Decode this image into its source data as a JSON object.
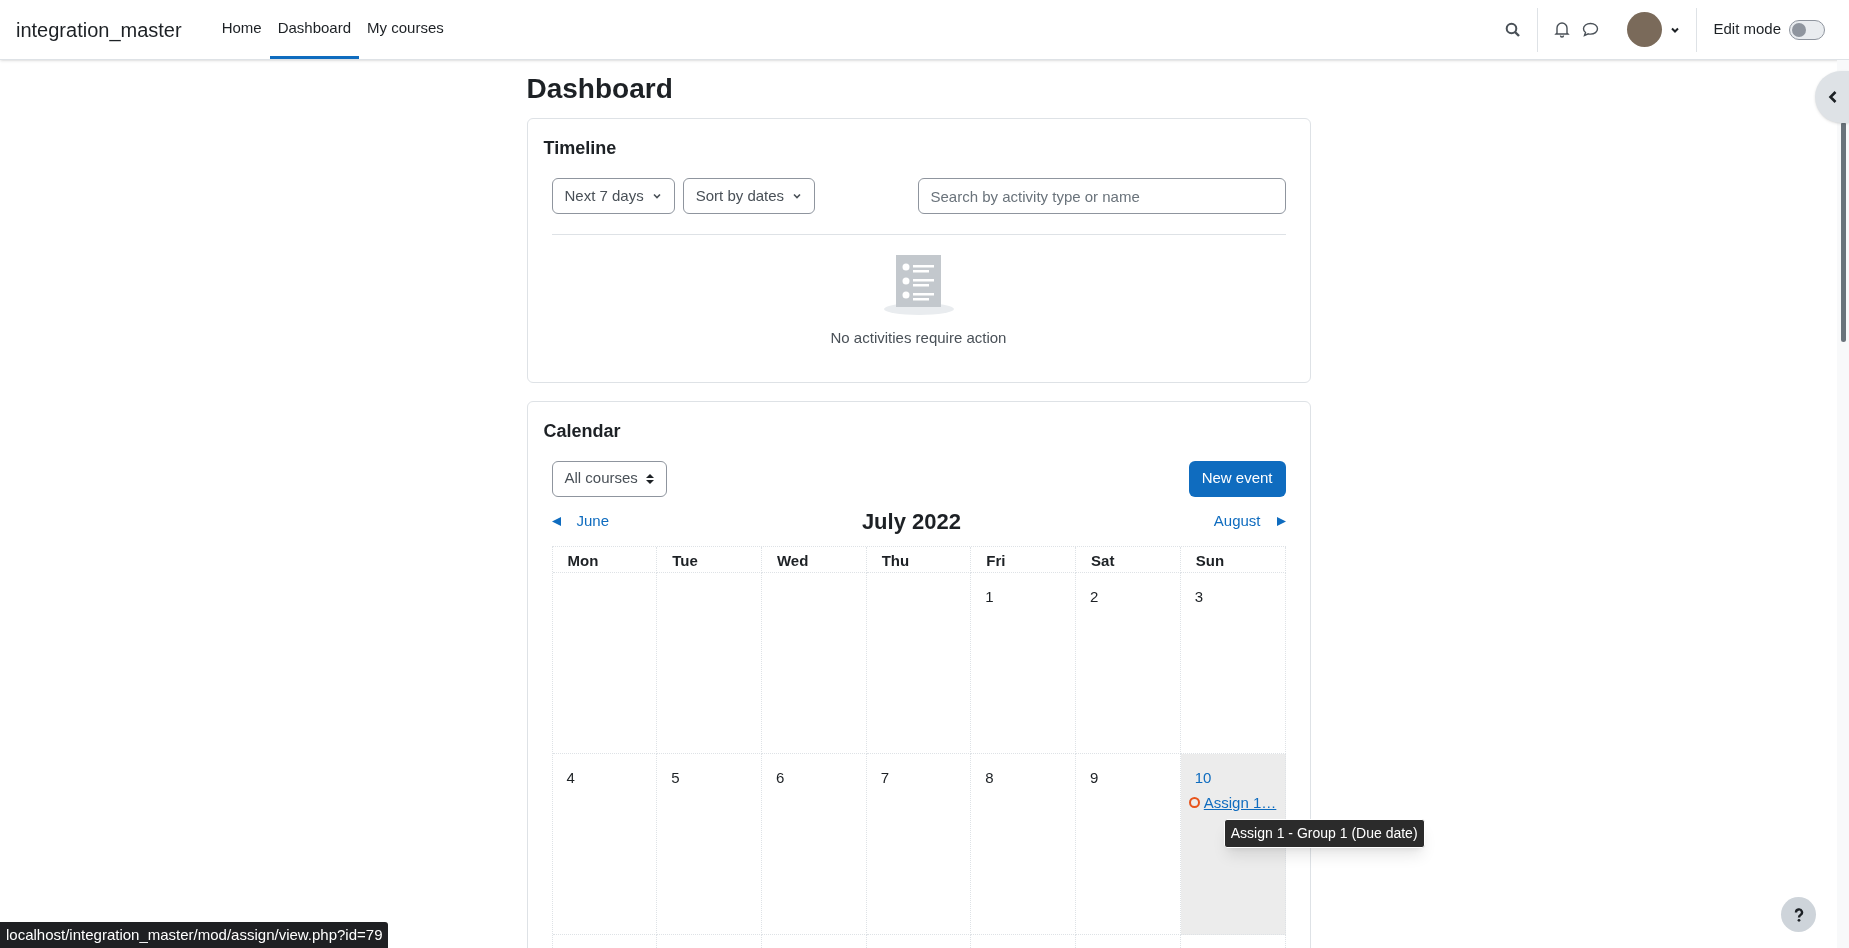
{
  "navbar": {
    "brand": "integration_master",
    "items": [
      {
        "label": "Home",
        "selected": false
      },
      {
        "label": "Dashboard",
        "selected": true
      },
      {
        "label": "My courses",
        "selected": false
      }
    ],
    "edit_mode": {
      "label": "Edit mode",
      "on": false
    }
  },
  "page_title": "Dashboard",
  "timeline": {
    "title": "Timeline",
    "filters": [
      "Next 7 days",
      "Sort by dates"
    ],
    "search": {
      "placeholder": "Search by activity type or name"
    },
    "empty_message": "No activities require action"
  },
  "calendar": {
    "title": "Calendar",
    "course_select": "All courses",
    "new_event_button": "New event",
    "prev_month": "June",
    "month": "July 2022",
    "next_month": "August",
    "weekdays": [
      "Mon",
      "Tue",
      "Wed",
      "Thu",
      "Fri",
      "Sat",
      "Sun"
    ],
    "weeks": [
      [
        {
          "day": "1",
          "today": false
        },
        {
          "day": "2",
          "today": false
        },
        {
          "day": "3",
          "today": false
        }
      ],
      [
        {
          "day": "4",
          "today": false
        },
        {
          "day": "5",
          "today": false
        },
        {
          "day": "6",
          "today": false
        },
        {
          "day": "7",
          "today": false
        },
        {
          "day": "8",
          "today": false
        },
        {
          "day": "9",
          "today": false
        },
        {
          "day": "10",
          "today": true,
          "events": [
            {
              "name": "Assign 1…",
              "color": "#e8541c",
              "tooltip": "Assign 1 - Group 1 (Due date)"
            }
          ]
        }
      ]
    ]
  },
  "status_url": "localhost/integration_master/mod/assign/view.php?id=79"
}
